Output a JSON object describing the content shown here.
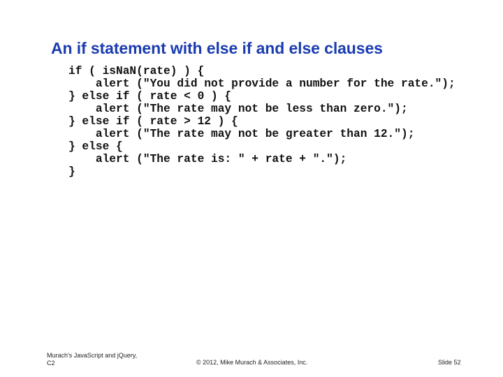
{
  "slide": {
    "title": "An if statement with else if and else clauses",
    "code_lines": [
      "if ( isNaN(rate) ) {",
      "    alert (\"You did not provide a number for the rate.\");",
      "} else if ( rate < 0 ) {",
      "    alert (\"The rate may not be less than zero.\");",
      "} else if ( rate > 12 ) {",
      "    alert (\"The rate may not be greater than 12.\");",
      "} else {",
      "    alert (\"The rate is: \" + rate + \".\");",
      "}"
    ],
    "footer": {
      "book_line1": "Murach's JavaScript and jQuery,",
      "book_line2": "C2",
      "copyright": "© 2012, Mike Murach & Associates, Inc.",
      "slide_number": "Slide 52"
    }
  },
  "colors": {
    "title": "#1a3cb0",
    "code": "#111111",
    "background": "#ffffff"
  }
}
